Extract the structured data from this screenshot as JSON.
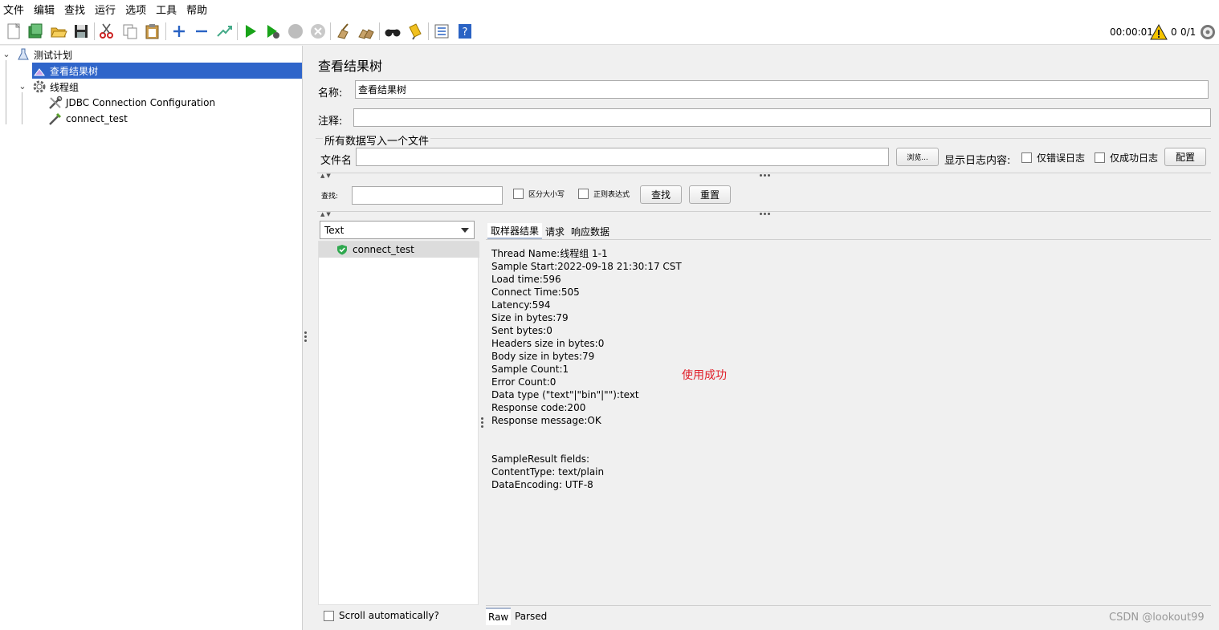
{
  "menu": [
    "文件",
    "编辑",
    "查找",
    "运行",
    "选项",
    "工具",
    "帮助"
  ],
  "status": {
    "elapsed": "00:00:01",
    "warnings": "0",
    "threads": "0/1"
  },
  "tree": {
    "root": "测试计划",
    "listener": "查看结果树",
    "thread_group": "线程组",
    "config": "JDBC Connection Configuration",
    "sampler": "connect_test"
  },
  "form": {
    "title": "查看结果树",
    "name_label": "名称:",
    "name_value": "查看结果树",
    "comment_label": "注释:",
    "comment_value": "",
    "file_group": "所有数据写入一个文件",
    "filename_label": "文件名",
    "filename_value": "",
    "browse": "浏览...",
    "log_label": "显示日志内容:",
    "errors_only": "仅错误日志",
    "success_only": "仅成功日志",
    "configure": "配置"
  },
  "search": {
    "label": "查找:",
    "value": "",
    "case_sensitive": "区分大小写",
    "regex": "正则表达式",
    "find": "查找",
    "reset": "重置"
  },
  "renderer": {
    "selected": "Text"
  },
  "samples": [
    "connect_test"
  ],
  "result_tabs": [
    "取样器结果",
    "请求",
    "响应数据"
  ],
  "result_lines": [
    "Thread Name:线程组 1-1",
    "Sample Start:2022-09-18 21:30:17 CST",
    "Load time:596",
    "Connect Time:505",
    "Latency:594",
    "Size in bytes:79",
    "Sent bytes:0",
    "Headers size in bytes:0",
    "Body size in bytes:79",
    "Sample Count:1",
    "Error Count:0",
    "Data type (\"text\"|\"bin\"|\"\"):text",
    "Response code:200",
    "Response message:OK",
    "",
    "",
    "SampleResult fields:",
    "ContentType: text/plain",
    "DataEncoding: UTF-8"
  ],
  "annotation": "使用成功",
  "scroll_auto": "Scroll automatically?",
  "bottom_tabs": [
    "Raw",
    "Parsed"
  ],
  "watermark": "CSDN @lookout99",
  "toolbar_icons": [
    "new-icon",
    "templates-icon",
    "open-icon",
    "save-icon",
    "cut-icon",
    "copy-icon",
    "paste-icon",
    "expand-icon",
    "collapse-icon",
    "toggle-icon",
    "start-icon",
    "start-no-pause-icon",
    "stop-icon",
    "shutdown-icon",
    "clear-icon",
    "clear-all-icon",
    "search-icon",
    "reset-search-icon",
    "function-helper-icon",
    "help-icon"
  ]
}
